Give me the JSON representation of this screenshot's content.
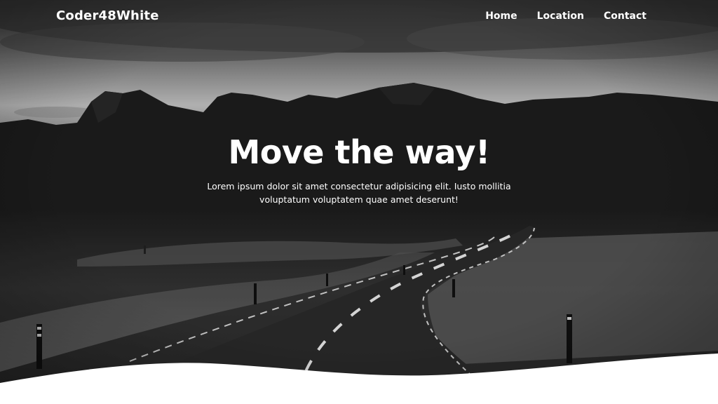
{
  "navbar": {
    "brand": "Coder48White",
    "links": [
      {
        "label": "Home"
      },
      {
        "label": "Location"
      },
      {
        "label": "Contact"
      }
    ]
  },
  "hero": {
    "title": "Move the way!",
    "subtitle": "Lorem ipsum dolor sit amet consectetur adipisicing elit. Iusto mollitia voluptatum voluptatem quae amet deserunt!"
  },
  "colors": {
    "text": "#ffffff",
    "page_background": "#ffffff",
    "sky": "#9a9a9a",
    "mountains": "#1f1f1f",
    "road": "#2c2c2c"
  }
}
